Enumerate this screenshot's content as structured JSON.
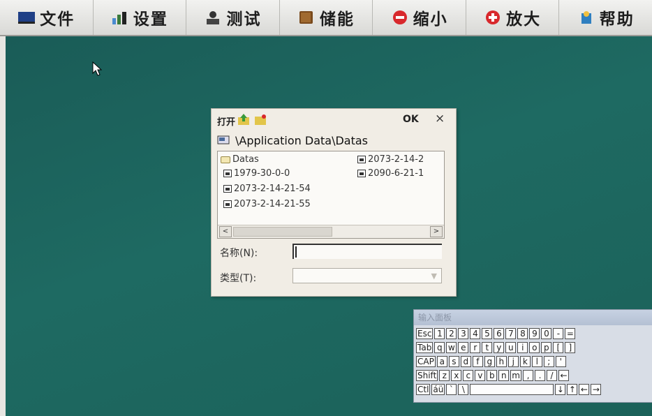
{
  "toolbar": {
    "items": [
      {
        "label": "文件",
        "icon": "monitor-icon"
      },
      {
        "label": "设置",
        "icon": "chart-icon"
      },
      {
        "label": "测试",
        "icon": "person-icon"
      },
      {
        "label": "储能",
        "icon": "book-icon"
      },
      {
        "label": "缩小",
        "icon": "minus-circle-icon"
      },
      {
        "label": "放大",
        "icon": "plus-circle-icon"
      },
      {
        "label": "帮助",
        "icon": "help-icon"
      }
    ]
  },
  "dialog": {
    "title": "打开",
    "ok_label": "OK",
    "close_label": "×",
    "path": "\\Application Data\\Datas",
    "files": [
      {
        "name": "Datas",
        "type": "folder"
      },
      {
        "name": "1979-30-0-0",
        "type": "file"
      },
      {
        "name": "2073-2-14-21-54",
        "type": "file"
      },
      {
        "name": "2073-2-14-21-55",
        "type": "file"
      },
      {
        "name": "2073-2-14-2",
        "type": "file"
      },
      {
        "name": "2090-6-21-1",
        "type": "file"
      }
    ],
    "name_label": "名称(N):",
    "name_value": "",
    "type_label": "类型(T):",
    "type_value": ""
  },
  "keyboard": {
    "title": "输入面板",
    "rows": [
      [
        "Esc",
        "1",
        "2",
        "3",
        "4",
        "5",
        "6",
        "7",
        "8",
        "9",
        "0",
        "-",
        "="
      ],
      [
        "Tab",
        "q",
        "w",
        "e",
        "r",
        "t",
        "y",
        "u",
        "i",
        "o",
        "p",
        "[",
        "]"
      ],
      [
        "CAP",
        "a",
        "s",
        "d",
        "f",
        "g",
        "h",
        "j",
        "k",
        "l",
        ";",
        "'"
      ],
      [
        "Shift",
        "z",
        "x",
        "c",
        "v",
        "b",
        "n",
        "m",
        ",",
        ".",
        "/",
        "←"
      ],
      [
        "Ctl",
        "áü",
        "`",
        "\\",
        " ",
        "↓",
        "↑",
        "←",
        "→"
      ]
    ]
  },
  "colors": {
    "desktop": "#1e6a62",
    "toolbar": "#e3e3e0",
    "dialog": "#f1ede5"
  }
}
